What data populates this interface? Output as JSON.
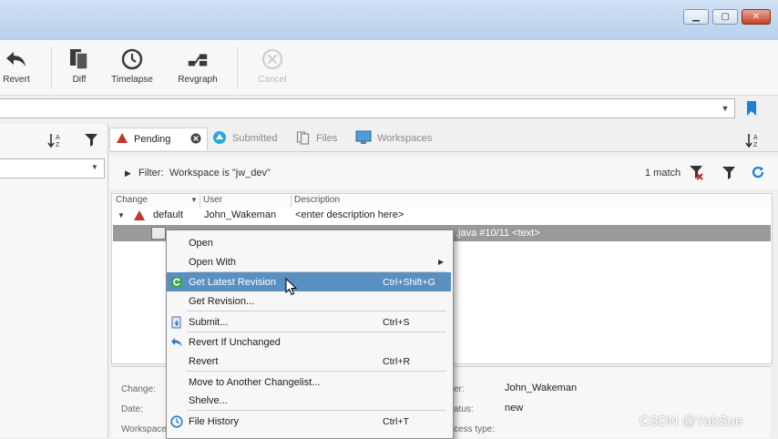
{
  "toolbar": {
    "revert": "Revert",
    "diff": "Diff",
    "timelapse": "Timelapse",
    "revgraph": "Revgraph",
    "cancel": "Cancel"
  },
  "tabs": [
    {
      "label": "Pending"
    },
    {
      "label": "Submitted"
    },
    {
      "label": "Files"
    },
    {
      "label": "Workspaces"
    }
  ],
  "filter": {
    "label": "Filter:",
    "text": "Workspace is \"jw_dev\"",
    "match_count": "1 match"
  },
  "grid": {
    "columns": [
      "Change",
      "User",
      "Description"
    ],
    "rows": [
      {
        "change": "default",
        "user": "John_Wakeman",
        "description": "<enter description here>"
      }
    ],
    "selected_file_tail": ".java #10/11 <text>"
  },
  "context_menu": {
    "items": [
      {
        "label": "Open",
        "shortcut": ""
      },
      {
        "label": "Open With",
        "shortcut": "",
        "submenu": true
      },
      {
        "label": "Get Latest Revision",
        "shortcut": "Ctrl+Shift+G",
        "highlighted": true
      },
      {
        "label": "Get Revision...",
        "shortcut": ""
      },
      {
        "label": "Submit...",
        "shortcut": "Ctrl+S"
      },
      {
        "label": "Revert If Unchanged",
        "shortcut": ""
      },
      {
        "label": "Revert",
        "shortcut": "Ctrl+R"
      },
      {
        "label": "Move to Another Changelist...",
        "shortcut": ""
      },
      {
        "label": "Shelve...",
        "shortcut": ""
      },
      {
        "label": "File History",
        "shortcut": "Ctrl+T"
      }
    ]
  },
  "details": {
    "change_label": "Change:",
    "date_label": "Date:",
    "workspace_label": "Workspace",
    "user_label": "er:",
    "user_value": "John_Wakeman",
    "status_label": "atus:",
    "status_value": "new",
    "access_label": "cess type:"
  },
  "watermark": "CSDN @YakSue",
  "colors": {
    "accent": "#5a8fc2",
    "pending_red": "#c0392b",
    "bookmark_blue": "#1e7fd6"
  }
}
